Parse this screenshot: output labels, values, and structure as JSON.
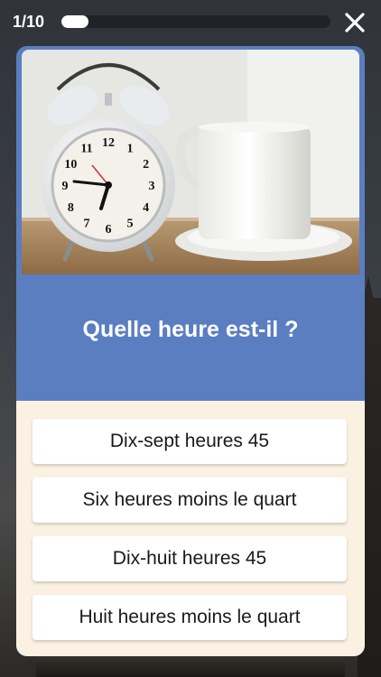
{
  "header": {
    "counter": "1/10",
    "progress_fraction": 0.1,
    "close_icon": "close-icon"
  },
  "quiz": {
    "image_alt_icon": "alarm-clock-and-cup-photo",
    "clock_numerals": [
      "12",
      "1",
      "2",
      "3",
      "4",
      "5",
      "6",
      "7",
      "8",
      "9",
      "10",
      "11"
    ],
    "question": "Quelle heure est-il ?",
    "answers": [
      "Dix-sept heures 45",
      "Six heures moins le quart",
      "Dix-huit heures 45",
      "Huit heures moins le quart"
    ]
  },
  "colors": {
    "card_blue": "#5a7ec0",
    "answers_bg": "#fbf1e3"
  }
}
